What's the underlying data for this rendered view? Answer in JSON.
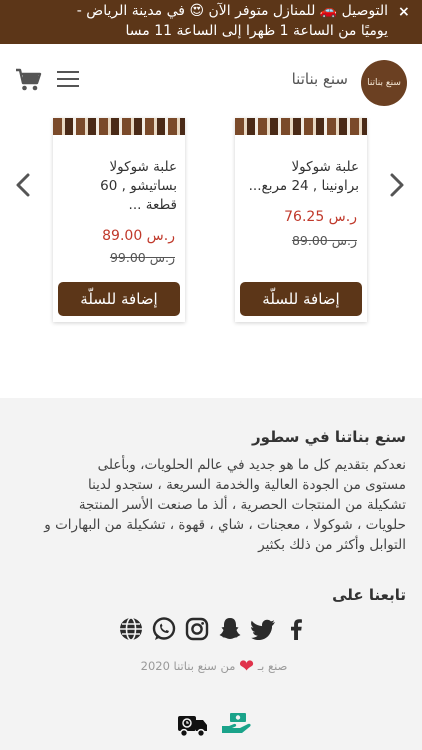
{
  "announcement": {
    "close": "×",
    "line1": "التوصيل 🚗 للمنازل متوفر الآن 😍 في مدينة الرياض -",
    "line2": "يوميًا من الساعة 1 ظهرا إلى الساعة 11 مسا"
  },
  "header": {
    "brand": "سنع بناتنا",
    "logo_text": "سنع بناتنا",
    "cart_icon": "cart-icon",
    "menu_icon": "hamburger-icon"
  },
  "products": [
    {
      "name_line1": "علبة شوكولا",
      "name_line2": "براونينا , 24 مربع...",
      "price": "ر.س 76.25",
      "old_price": "ر.س 89.00",
      "add_label": "إضافة للسلّة"
    },
    {
      "name_line1": "علبة شوكولا",
      "name_line2": "بساتيشو , 60",
      "name_line3": "قطعة ...",
      "price": "ر.س 89.00",
      "old_price": "ر.س 99.00",
      "add_label": "إضافة للسلّة"
    }
  ],
  "footer": {
    "about_title": "سنع بناتنا في سطور",
    "about_lines": [
      "نعدكم بتقديم كل ما هو جديد في عالم الحلويات، وبأعلى",
      "مستوى من الجودة العالية والخدمة السريعة ، ستجدو لدينا",
      "تشكيلة من المنتجات الحصرية ، ألذ ما صنعت الأسر المنتجة",
      "حلويات ، شوكولا ، معجنات ، شاي ، قهوة ، تشكيلة من البهارات و",
      "التوابل وأكثر من ذلك بكثير"
    ],
    "follow_title": "تابعنا على",
    "made_prefix": "صنع بـ",
    "made_suffix": "من سنع بناتنا 2020"
  },
  "colors": {
    "brand_brown": "#5c3618",
    "price_red": "#c0392b",
    "heart": "#e0324b",
    "green_icon": "#1aa38a"
  }
}
